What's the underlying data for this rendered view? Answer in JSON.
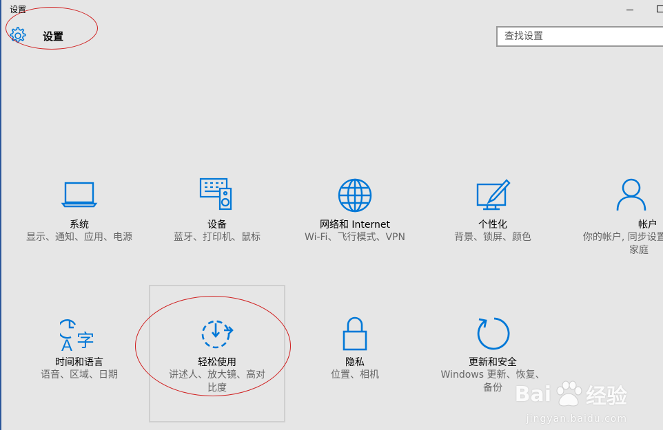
{
  "window": {
    "title": "设置"
  },
  "header": {
    "title": "设置",
    "icon": "gear-icon"
  },
  "search": {
    "placeholder": "查找设置"
  },
  "accent_color": "#0078d7",
  "tiles": [
    {
      "name": "系统",
      "desc": "显示、通知、应用、电源",
      "icon": "monitor-icon"
    },
    {
      "name": "设备",
      "desc": "蓝牙、打印机、鼠标",
      "icon": "devices-icon"
    },
    {
      "name": "网络和 Internet",
      "desc": "Wi-Fi、飞行模式、VPN",
      "icon": "globe-icon"
    },
    {
      "name": "个性化",
      "desc": "背景、锁屏、颜色",
      "icon": "personalization-icon"
    },
    {
      "name": "帐户",
      "desc": "你的帐户, 同步设置, 工作, 家庭",
      "icon": "person-icon"
    },
    {
      "name": "时间和语言",
      "desc": "语音、区域、日期",
      "icon": "time-language-icon"
    },
    {
      "name": "轻松使用",
      "desc": "讲述人、放大镜、高对比度",
      "icon": "ease-of-access-icon"
    },
    {
      "name": "隐私",
      "desc": "位置、相机",
      "icon": "lock-icon"
    },
    {
      "name": "更新和安全",
      "desc": "Windows 更新、恢复、备份",
      "icon": "refresh-icon"
    }
  ],
  "watermark": {
    "brand_left": "Bai",
    "brand_right": "经验",
    "url": "jingyan.baidu.com"
  }
}
